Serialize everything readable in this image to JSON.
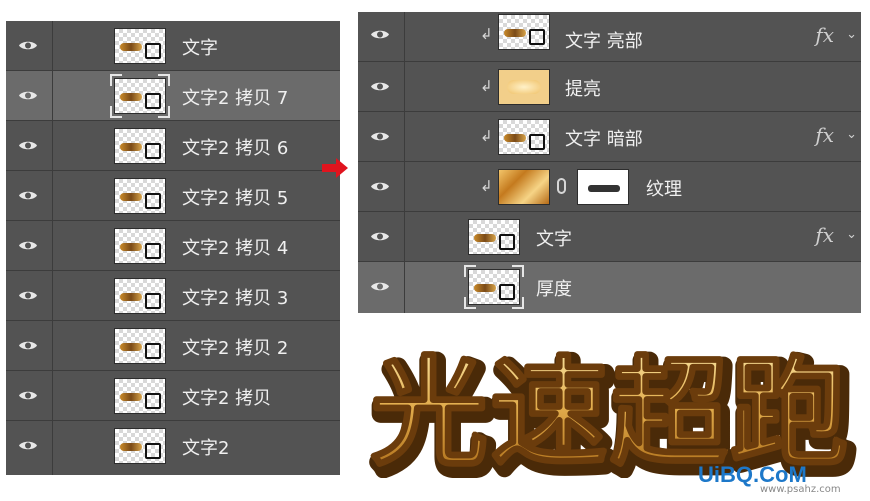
{
  "left_panel": {
    "layers": [
      {
        "name": "文字",
        "selected": false
      },
      {
        "name": "文字2 拷贝 7",
        "selected": true
      },
      {
        "name": "文字2 拷贝 6",
        "selected": false
      },
      {
        "name": "文字2 拷贝 5",
        "selected": false
      },
      {
        "name": "文字2 拷贝 4",
        "selected": false
      },
      {
        "name": "文字2 拷贝 3",
        "selected": false
      },
      {
        "name": "文字2 拷贝 2",
        "selected": false
      },
      {
        "name": "文字2 拷贝",
        "selected": false
      },
      {
        "name": "文字2",
        "selected": false
      }
    ]
  },
  "right_panel": {
    "layers": [
      {
        "name": "文字 亮部",
        "fx": "fx",
        "clipped": true
      },
      {
        "name": "提亮",
        "clipped": true
      },
      {
        "name": "文字 暗部",
        "fx": "fx",
        "clipped": true
      },
      {
        "name": "纹理",
        "clipped": true,
        "has_mask": true
      },
      {
        "name": "文字",
        "fx": "fx",
        "clipped": false
      },
      {
        "name": "厚度",
        "clipped": false,
        "selected": true
      }
    ]
  },
  "artwork": {
    "title": "光速超跑"
  },
  "watermark": {
    "text": "UiBQ.CoM",
    "url": "www.psahz.com"
  },
  "colors": {
    "panel": "#535353",
    "selected_row": "#6b6b6b",
    "arrow": "#e0141e",
    "gold": "#d9a441",
    "watermark": "#1d78c9"
  },
  "icons": {
    "visibility": "eye-icon",
    "clipping": "clipping-arrow-icon",
    "link": "chain-link-icon",
    "effects": "fx-icon",
    "expand": "chevron-down-icon"
  }
}
